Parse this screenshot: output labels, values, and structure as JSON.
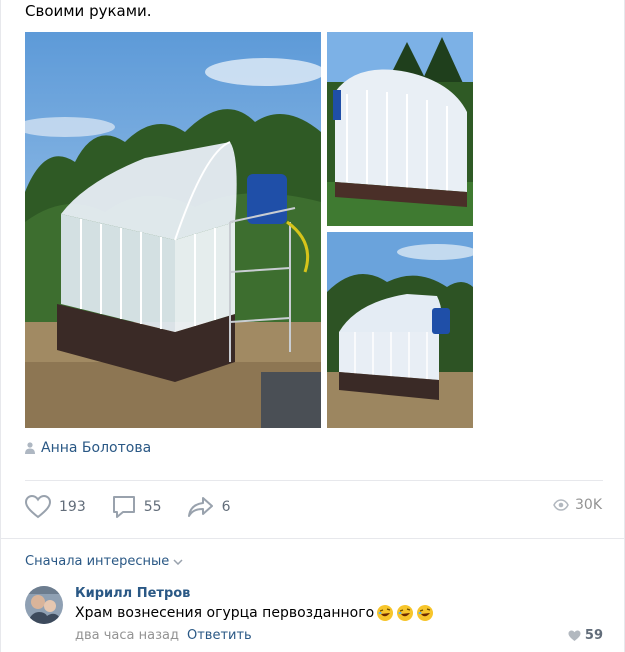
{
  "post": {
    "text": "Своими руками.",
    "author": "Анна Болотова"
  },
  "actions": {
    "likes": "193",
    "comments": "55",
    "shares": "6",
    "views": "30K"
  },
  "comments_section": {
    "sort_label": "Сначала интересные",
    "items": [
      {
        "author": "Кирилл Петров",
        "text": "Храм вознесения огурца первозданного",
        "time": "два часа назад",
        "reply_label": "Ответить",
        "likes": "59"
      }
    ]
  },
  "icons": {
    "like": "heart-icon",
    "comment": "speech-bubble-icon",
    "share": "share-arrow-icon",
    "views": "eye-icon",
    "sort": "chevron-down-icon",
    "author": "person-icon",
    "emoji": "rofl-emoji-icon"
  },
  "colors": {
    "link": "#2a5885",
    "muted": "#939393",
    "icon": "#99a2ad",
    "divider": "#e7e8ec"
  }
}
